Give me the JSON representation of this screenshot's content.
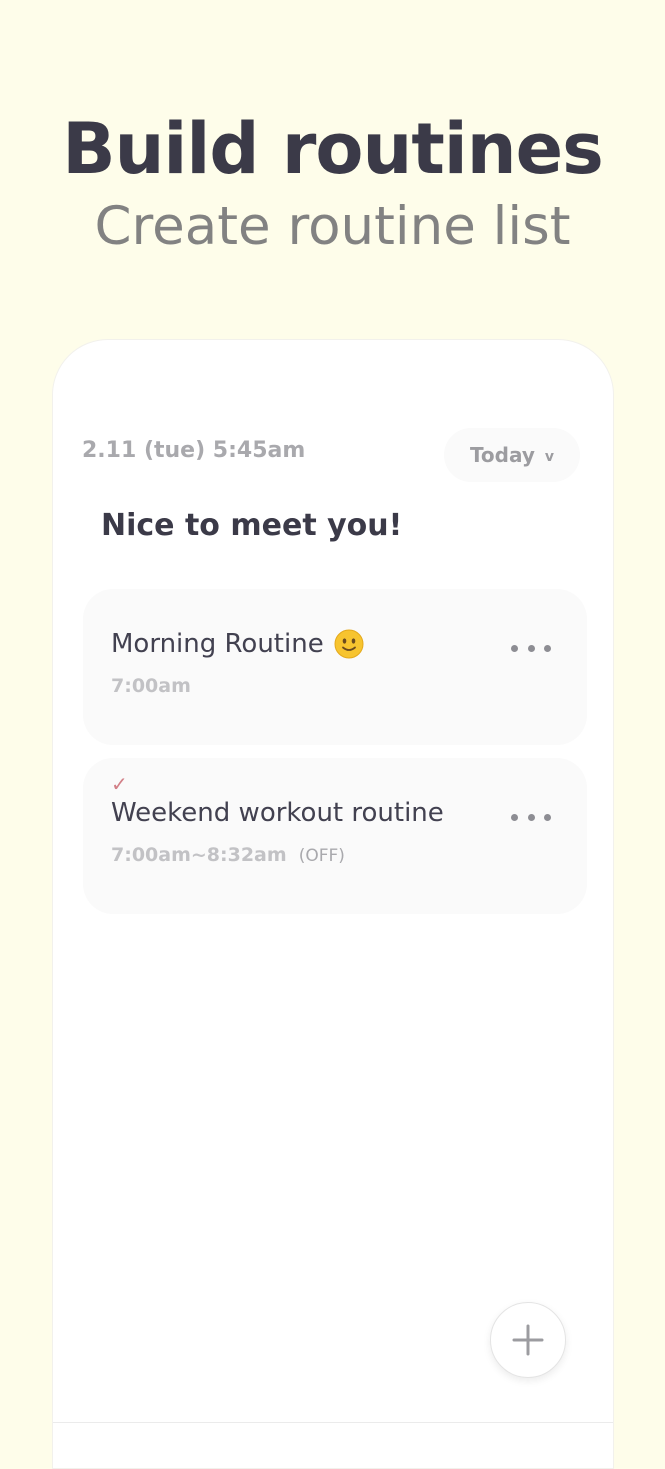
{
  "hero": {
    "title": "Build routines",
    "subtitle": "Create routine list"
  },
  "header": {
    "date": "2.11 (tue) 5:45am",
    "filter_label": "Today",
    "filter_chevron": "v"
  },
  "greeting": "Nice to meet you!",
  "routines": [
    {
      "name": "Morning Routine",
      "emoji_icon": "slightly-smiling-face-icon",
      "time": "7:00am",
      "status": ""
    },
    {
      "name": "Weekend workout routine",
      "check_icon": "check-icon",
      "check_symbol": "✓",
      "time": "7:00am~8:32am",
      "status": "(OFF)"
    }
  ],
  "colors": {
    "background": "#fefdea",
    "title": "#3b3a48",
    "subtitle": "#828282",
    "card": "#fafafa",
    "check": "#d27f87"
  }
}
